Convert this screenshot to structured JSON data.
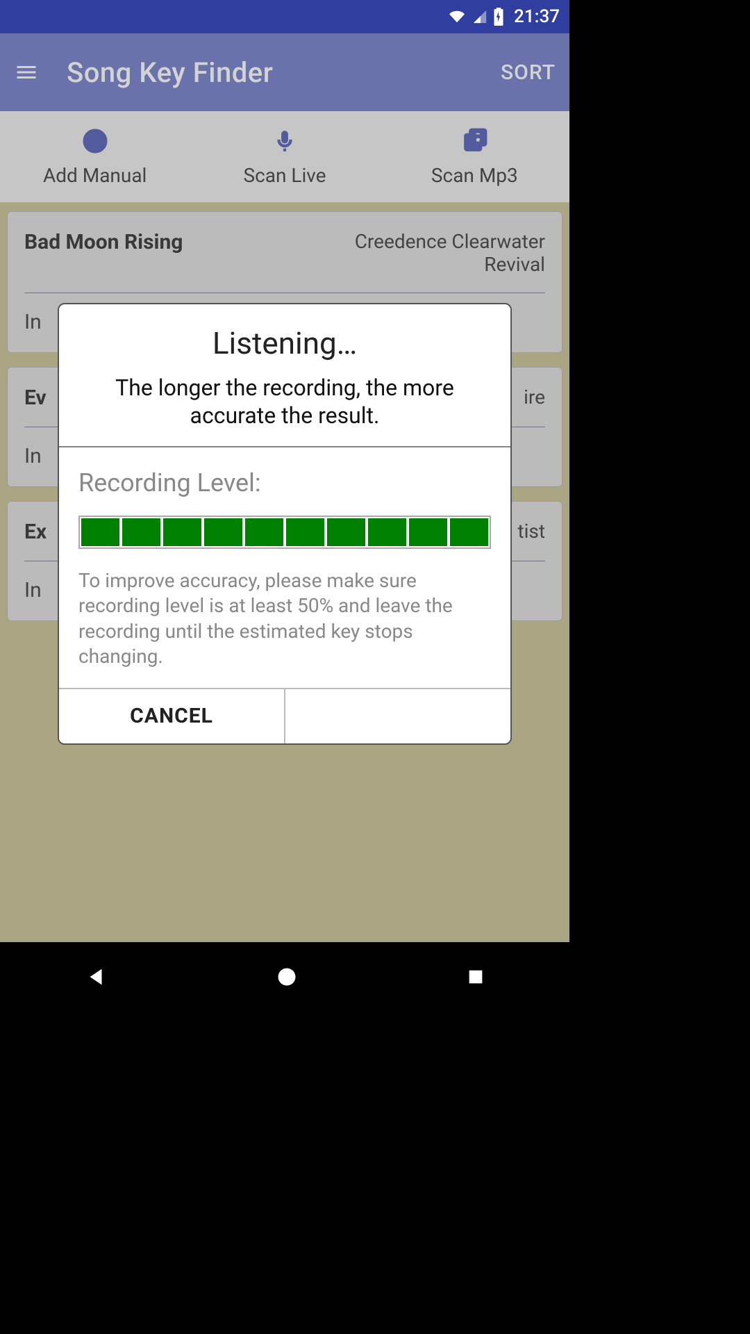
{
  "status": {
    "time": "21:37"
  },
  "appbar": {
    "title": "Song Key Finder",
    "sort_label": "SORT"
  },
  "actions": {
    "add_manual": "Add Manual",
    "scan_live": "Scan Live",
    "scan_mp3": "Scan Mp3"
  },
  "songs": [
    {
      "title": "Bad Moon Rising",
      "artist": "Creedence Clearwater Revival",
      "key_prefix": "In"
    },
    {
      "title": "Ev",
      "artist": "ire",
      "key_prefix": "In"
    },
    {
      "title": "Ex",
      "artist": "tist",
      "key_prefix": "In"
    }
  ],
  "dialog": {
    "title": "Listening…",
    "subtitle": "The longer the recording, the more accurate the result.",
    "recording_label": "Recording Level:",
    "level_segments_filled": 10,
    "hint": "To improve accuracy, please make sure recording level is at least 50% and leave the recording until the estimated key stops changing.",
    "cancel_label": "CANCEL"
  }
}
